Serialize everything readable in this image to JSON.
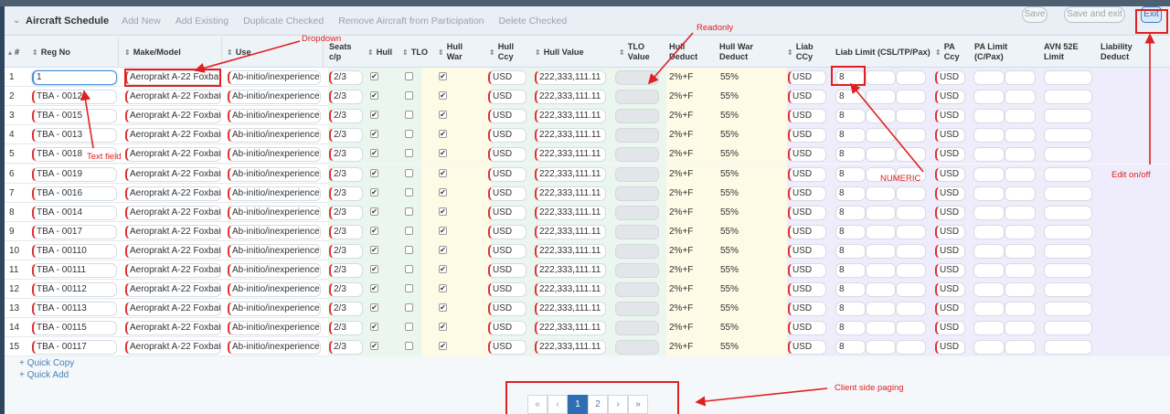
{
  "toolbar": {
    "title": "Aircraft Schedule",
    "links": [
      "Add New",
      "Add Existing",
      "Duplicate Checked",
      "Remove Aircraft from Participation",
      "Delete Checked"
    ],
    "save_label": "Save",
    "save_exit_label": "Save and exit",
    "exit_label": "Exit"
  },
  "columns": {
    "num": "#",
    "reg_no": "Reg No",
    "make_model": "Make/Model",
    "use": "Use",
    "seats": "Seats c/p",
    "hull": "Hull",
    "tlo": "TLO",
    "hull_war": "Hull War",
    "hull_ccy": "Hull Ccy",
    "hull_value": "Hull Value",
    "tlo_value": "TLO Value",
    "hull_deduct": "Hull Deduct",
    "hull_war_deduct": "Hull War Deduct",
    "liab_ccy": "Liab CCy",
    "liab_limit": "Liab Limit (CSL/TP/Pax)",
    "pa_ccy": "PA Ccy",
    "pa_limit": "PA Limit (C/Pax)",
    "avn52e": "AVN 52E Limit",
    "liab_deduct": "Liability Deduct"
  },
  "rows": [
    {
      "n": "1",
      "reg": "1",
      "make": "Aeroprakt A-22 Foxbat",
      "use": "Ab-initio/inexperienced",
      "seats": "2/3",
      "hull": "✔",
      "tlo": "",
      "war": "✔",
      "hccy": "USD",
      "hval": "222,333,111.11",
      "hded": "2%+F",
      "hwded": "55%",
      "lccy": "USD",
      "llim": "8",
      "pccy": "USD"
    },
    {
      "n": "2",
      "reg": "TBA - 0012",
      "make": "Aeroprakt A-22 Foxbat",
      "use": "Ab-initio/inexperienced",
      "seats": "2/3",
      "hull": "✔",
      "tlo": "",
      "war": "✔",
      "hccy": "USD",
      "hval": "222,333,111.11",
      "hded": "2%+F",
      "hwded": "55%",
      "lccy": "USD",
      "llim": "8",
      "pccy": "USD"
    },
    {
      "n": "3",
      "reg": "TBA - 0015",
      "make": "Aeroprakt A-22 Foxbat",
      "use": "Ab-initio/inexperienced",
      "seats": "2/3",
      "hull": "✔",
      "tlo": "",
      "war": "✔",
      "hccy": "USD",
      "hval": "222,333,111.11",
      "hded": "2%+F",
      "hwded": "55%",
      "lccy": "USD",
      "llim": "8",
      "pccy": "USD"
    },
    {
      "n": "4",
      "reg": "TBA - 0013",
      "make": "Aeroprakt A-22 Foxbat",
      "use": "Ab-initio/inexperienced",
      "seats": "2/3",
      "hull": "✔",
      "tlo": "",
      "war": "✔",
      "hccy": "USD",
      "hval": "222,333,111.11",
      "hded": "2%+F",
      "hwded": "55%",
      "lccy": "USD",
      "llim": "8",
      "pccy": "USD"
    },
    {
      "n": "5",
      "reg": "TBA - 0018",
      "make": "Aeroprakt A-22 Foxbat",
      "use": "Ab-initio/inexperienced",
      "seats": "2/3",
      "hull": "✔",
      "tlo": "",
      "war": "✔",
      "hccy": "USD",
      "hval": "222,333,111.11",
      "hded": "2%+F",
      "hwded": "55%",
      "lccy": "USD",
      "llim": "8",
      "pccy": "USD"
    },
    {
      "n": "6",
      "reg": "TBA - 0019",
      "make": "Aeroprakt A-22 Foxbat",
      "use": "Ab-initio/inexperienced",
      "seats": "2/3",
      "hull": "✔",
      "tlo": "",
      "war": "✔",
      "hccy": "USD",
      "hval": "222,333,111.11",
      "hded": "2%+F",
      "hwded": "55%",
      "lccy": "USD",
      "llim": "8",
      "pccy": "USD"
    },
    {
      "n": "7",
      "reg": "TBA - 0016",
      "make": "Aeroprakt A-22 Foxbat",
      "use": "Ab-initio/inexperienced",
      "seats": "2/3",
      "hull": "✔",
      "tlo": "",
      "war": "✔",
      "hccy": "USD",
      "hval": "222,333,111.11",
      "hded": "2%+F",
      "hwded": "55%",
      "lccy": "USD",
      "llim": "8",
      "pccy": "USD"
    },
    {
      "n": "8",
      "reg": "TBA - 0014",
      "make": "Aeroprakt A-22 Foxbat",
      "use": "Ab-initio/inexperienced",
      "seats": "2/3",
      "hull": "✔",
      "tlo": "",
      "war": "✔",
      "hccy": "USD",
      "hval": "222,333,111.11",
      "hded": "2%+F",
      "hwded": "55%",
      "lccy": "USD",
      "llim": "8",
      "pccy": "USD"
    },
    {
      "n": "9",
      "reg": "TBA - 0017",
      "make": "Aeroprakt A-22 Foxbat",
      "use": "Ab-initio/inexperienced",
      "seats": "2/3",
      "hull": "✔",
      "tlo": "",
      "war": "✔",
      "hccy": "USD",
      "hval": "222,333,111.11",
      "hded": "2%+F",
      "hwded": "55%",
      "lccy": "USD",
      "llim": "8",
      "pccy": "USD"
    },
    {
      "n": "10",
      "reg": "TBA - 00110",
      "make": "Aeroprakt A-22 Foxbat",
      "use": "Ab-initio/inexperienced",
      "seats": "2/3",
      "hull": "✔",
      "tlo": "",
      "war": "✔",
      "hccy": "USD",
      "hval": "222,333,111.11",
      "hded": "2%+F",
      "hwded": "55%",
      "lccy": "USD",
      "llim": "8",
      "pccy": "USD"
    },
    {
      "n": "11",
      "reg": "TBA - 00111",
      "make": "Aeroprakt A-22 Foxbat",
      "use": "Ab-initio/inexperienced",
      "seats": "2/3",
      "hull": "✔",
      "tlo": "",
      "war": "✔",
      "hccy": "USD",
      "hval": "222,333,111.11",
      "hded": "2%+F",
      "hwded": "55%",
      "lccy": "USD",
      "llim": "8",
      "pccy": "USD"
    },
    {
      "n": "12",
      "reg": "TBA - 00112",
      "make": "Aeroprakt A-22 Foxbat",
      "use": "Ab-initio/inexperienced",
      "seats": "2/3",
      "hull": "✔",
      "tlo": "",
      "war": "✔",
      "hccy": "USD",
      "hval": "222,333,111.11",
      "hded": "2%+F",
      "hwded": "55%",
      "lccy": "USD",
      "llim": "8",
      "pccy": "USD"
    },
    {
      "n": "13",
      "reg": "TBA - 00113",
      "make": "Aeroprakt A-22 Foxbat",
      "use": "Ab-initio/inexperienced",
      "seats": "2/3",
      "hull": "✔",
      "tlo": "",
      "war": "✔",
      "hccy": "USD",
      "hval": "222,333,111.11",
      "hded": "2%+F",
      "hwded": "55%",
      "lccy": "USD",
      "llim": "8",
      "pccy": "USD"
    },
    {
      "n": "14",
      "reg": "TBA - 00115",
      "make": "Aeroprakt A-22 Foxbat",
      "use": "Ab-initio/inexperienced",
      "seats": "2/3",
      "hull": "✔",
      "tlo": "",
      "war": "✔",
      "hccy": "USD",
      "hval": "222,333,111.11",
      "hded": "2%+F",
      "hwded": "55%",
      "lccy": "USD",
      "llim": "8",
      "pccy": "USD"
    },
    {
      "n": "15",
      "reg": "TBA - 00117",
      "make": "Aeroprakt A-22 Foxbat",
      "use": "Ab-initio/inexperienced",
      "seats": "2/3",
      "hull": "✔",
      "tlo": "",
      "war": "✔",
      "hccy": "USD",
      "hval": "222,333,111.11",
      "hded": "2%+F",
      "hwded": "55%",
      "lccy": "USD",
      "llim": "8",
      "pccy": "USD"
    }
  ],
  "footer": {
    "quick_copy": "+ Quick Copy",
    "quick_add": "+ Quick Add"
  },
  "pagination": {
    "first": "«",
    "prev": "‹",
    "pages": [
      "1",
      "2"
    ],
    "current_page": "1",
    "next": "›",
    "last": "»"
  },
  "annotations": {
    "dropdown": "Dropdown",
    "readonly": "Readonly",
    "text_field": "Text field",
    "numeric": "NUMERIC",
    "edit_toggle": "Edit on/off",
    "client_paging": "Client side paging"
  },
  "colors": {
    "annotation_red": "#e02020",
    "accent_blue": "#2f6eb5",
    "required_marker": "#d33"
  }
}
